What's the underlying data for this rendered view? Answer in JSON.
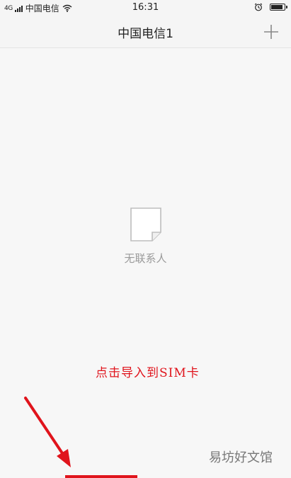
{
  "status_bar": {
    "signal_label": "4G",
    "carrier": "中国电信",
    "time": "16:31",
    "alarm_icon": "alarm-clock-icon",
    "battery_icon": "battery-icon"
  },
  "header": {
    "title": "中国电信1",
    "add_icon": "plus-icon"
  },
  "empty_state": {
    "icon": "blank-document-icon",
    "text": "无联系人"
  },
  "annotation": {
    "text": "点击导入到SIM卡",
    "color": "#e0141c"
  },
  "watermark": {
    "text": "易坊好文馆"
  },
  "colors": {
    "background": "#f7f7f7",
    "accent_red": "#e0141c"
  }
}
